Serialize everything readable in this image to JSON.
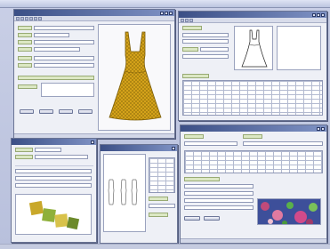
{
  "menubar": {
    "items": []
  },
  "windows": {
    "design": {
      "title": ""
    },
    "spec": {
      "title": ""
    },
    "swatches": {
      "title": ""
    },
    "sketch": {
      "title": ""
    },
    "fabric": {
      "title": ""
    }
  },
  "colors": {
    "window_title_bar": "#3b4f86",
    "label_green": "#dce8c4",
    "dress_gold": "#d4a21a",
    "desktop": "#c3cae3"
  },
  "icons": [
    "window-close-icon",
    "window-minimize-icon",
    "window-maximize-icon",
    "toolbar-icon"
  ]
}
